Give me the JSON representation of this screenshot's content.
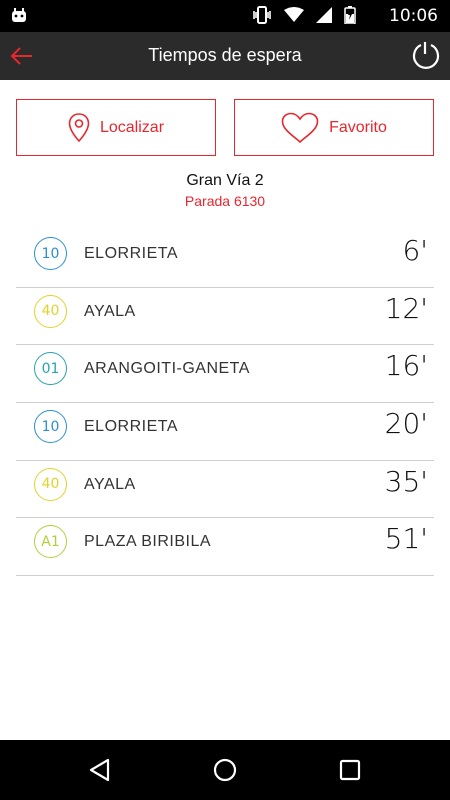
{
  "status_bar": {
    "time": "10:06"
  },
  "app_bar": {
    "title": "Tiempos de espera"
  },
  "actions": {
    "locate_label": "Localizar",
    "favorite_label": "Favorito"
  },
  "stop": {
    "name": "Gran Vía 2",
    "code": "Parada 6130"
  },
  "colors": {
    "accent": "#e8262d",
    "line10": "#2d8fd1",
    "line40": "#e2d22b",
    "line01": "#27a3b3",
    "lineA1": "#b3ce3c"
  },
  "arrivals": [
    {
      "line": "10",
      "destination": "ELORRIETA",
      "time": "6'",
      "color": "#2d8fd1"
    },
    {
      "line": "40",
      "destination": "AYALA",
      "time": "12'",
      "color": "#e2d22b"
    },
    {
      "line": "01",
      "destination": "ARANGOITI-GANETA",
      "time": "16'",
      "color": "#27a3b3"
    },
    {
      "line": "10",
      "destination": "ELORRIETA",
      "time": "20'",
      "color": "#2d8fd1"
    },
    {
      "line": "40",
      "destination": "AYALA",
      "time": "35'",
      "color": "#e2d22b"
    },
    {
      "line": "A1",
      "destination": "PLAZA BIRIBILA",
      "time": "51'",
      "color": "#b3ce3c"
    }
  ]
}
